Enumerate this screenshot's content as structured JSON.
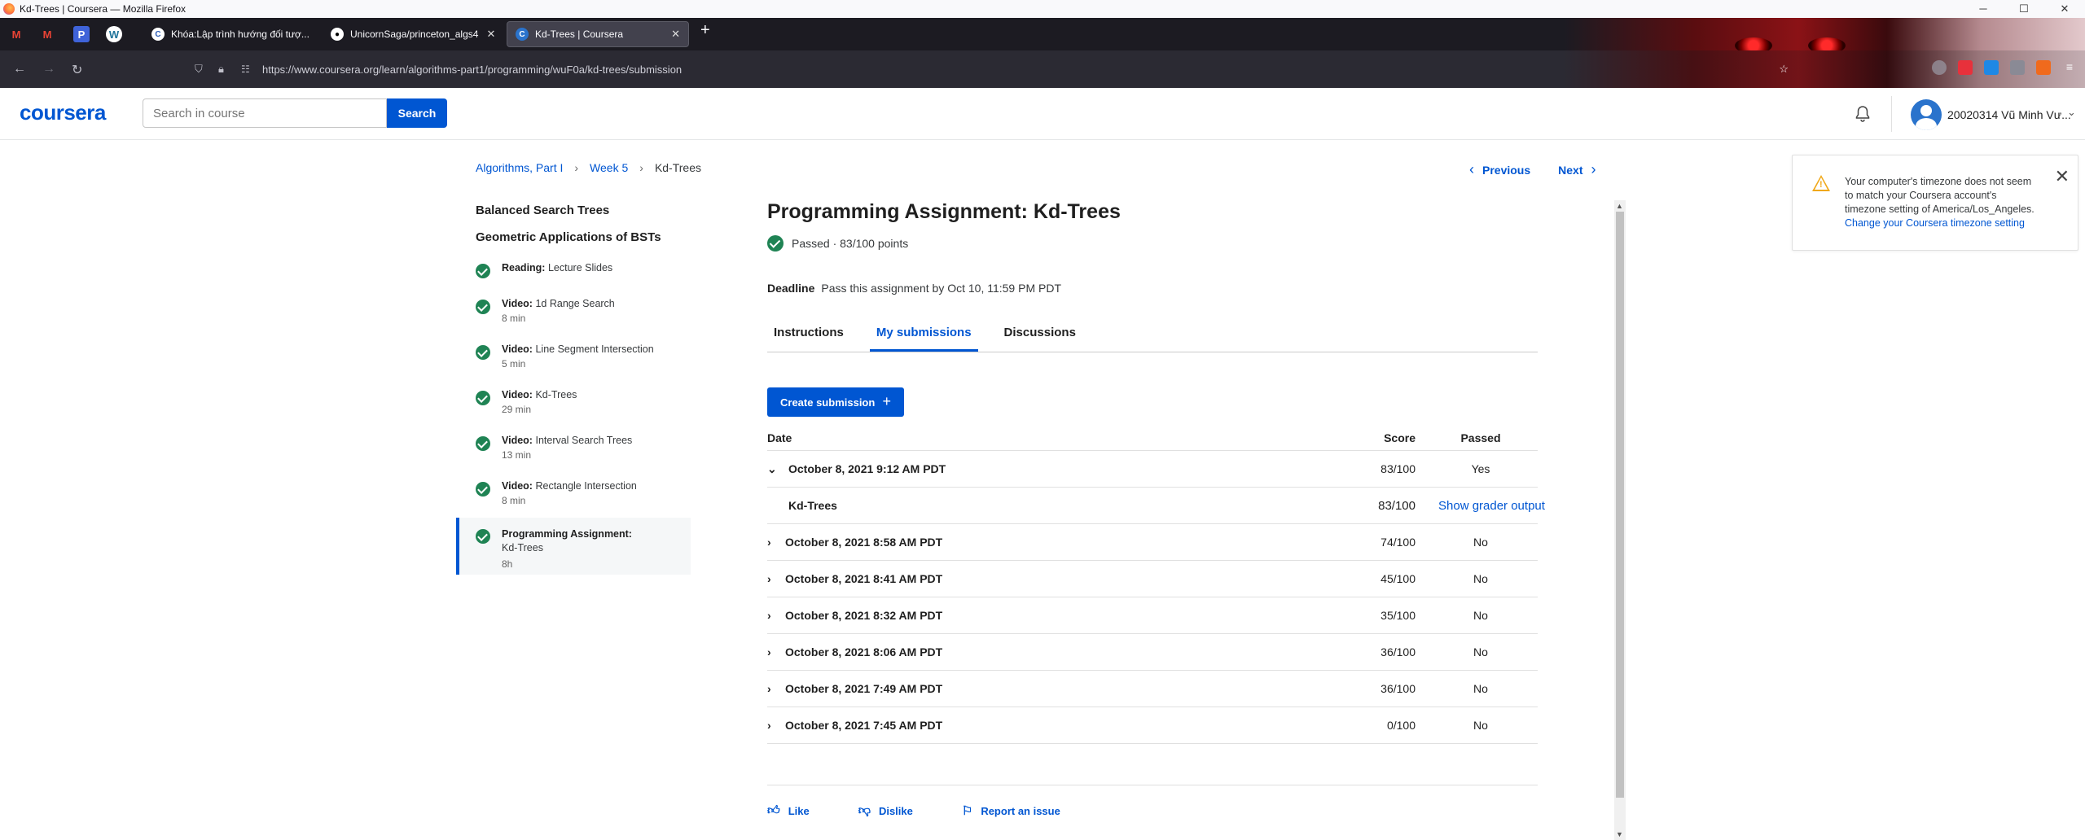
{
  "window": {
    "title": "Kd-Trees | Coursera — Mozilla Firefox"
  },
  "browser": {
    "tabs": [
      {
        "label": "Khóa:Lập trình hướng đối tượ..."
      },
      {
        "label": "UnicornSaga/princeton_algs4"
      },
      {
        "label": "Kd-Trees | Coursera"
      }
    ],
    "url": "https://www.coursera.org/learn/algorithms-part1/programming/wuF0a/kd-trees/submission"
  },
  "header": {
    "logo": "coursera",
    "search_placeholder": "Search in course",
    "search_button": "Search",
    "user_name": "20020314 Vũ Minh Vư..."
  },
  "breadcrumb": {
    "course": "Algorithms, Part I",
    "week": "Week 5",
    "current": "Kd-Trees"
  },
  "nav": {
    "previous": "Previous",
    "next": "Next"
  },
  "sidebar": {
    "section1": "Balanced Search Trees",
    "section2": "Geometric Applications of BSTs",
    "items": [
      {
        "type": "Reading:",
        "title": "Lecture Slides",
        "duration": ""
      },
      {
        "type": "Video:",
        "title": "1d Range Search",
        "duration": "8 min"
      },
      {
        "type": "Video:",
        "title": "Line Segment Intersection",
        "duration": "5 min"
      },
      {
        "type": "Video:",
        "title": "Kd-Trees",
        "duration": "29 min"
      },
      {
        "type": "Video:",
        "title": "Interval Search Trees",
        "duration": "13 min"
      },
      {
        "type": "Video:",
        "title": "Rectangle Intersection",
        "duration": "8 min"
      },
      {
        "type": "Programming Assignment:",
        "title": "Kd-Trees",
        "duration": "8h"
      }
    ]
  },
  "assignment": {
    "title": "Programming Assignment: Kd-Trees",
    "status": "Passed · 83/100 points",
    "deadline_label": "Deadline",
    "deadline_text": "Pass this assignment by Oct 10, 11:59 PM PDT"
  },
  "tabs": [
    "Instructions",
    "My submissions",
    "Discussions"
  ],
  "create_submission": "Create submission",
  "table": {
    "headers": {
      "date": "Date",
      "score": "Score",
      "passed": "Passed"
    },
    "expanded": {
      "date": "October 8, 2021 9:12 AM PDT",
      "score": "83/100",
      "passed": "Yes"
    },
    "part": {
      "name": "Kd-Trees",
      "score": "83/100",
      "link": "Show grader output"
    },
    "rows": [
      {
        "date": "October 8, 2021 8:58 AM PDT",
        "score": "74/100",
        "passed": "No"
      },
      {
        "date": "October 8, 2021 8:41 AM PDT",
        "score": "45/100",
        "passed": "No"
      },
      {
        "date": "October 8, 2021 8:32 AM PDT",
        "score": "35/100",
        "passed": "No"
      },
      {
        "date": "October 8, 2021 8:06 AM PDT",
        "score": "36/100",
        "passed": "No"
      },
      {
        "date": "October 8, 2021 7:49 AM PDT",
        "score": "36/100",
        "passed": "No"
      },
      {
        "date": "October 8, 2021 7:45 AM PDT",
        "score": "0/100",
        "passed": "No"
      }
    ]
  },
  "feedback": {
    "like": "Like",
    "dislike": "Dislike",
    "report": "Report an issue"
  },
  "toast": {
    "message": "Your computer's timezone does not seem to match your Coursera account's timezone setting of America/Los_Angeles.",
    "link": "Change your Coursera timezone setting"
  },
  "colors": {
    "brand": "#0056d2",
    "success": "#1f8354",
    "warning": "#f0a818"
  }
}
